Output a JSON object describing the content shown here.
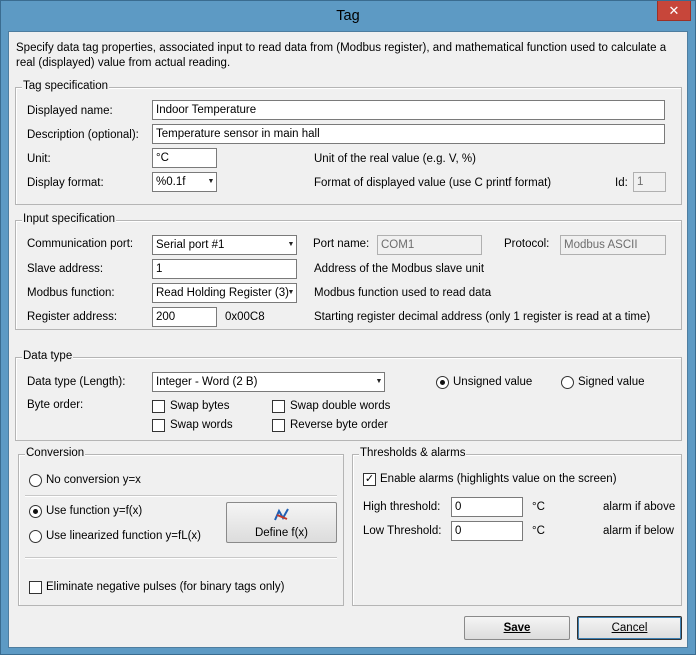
{
  "window": {
    "title": "Tag",
    "close_glyph": "✕"
  },
  "intro": "Specify data tag properties, associated input to read data from (Modbus register), and mathematical function used to calculate a real (displayed) value from actual reading.",
  "tag_spec": {
    "legend": "Tag specification",
    "displayed_name_label": "Displayed name:",
    "displayed_name_value": "Indoor Temperature",
    "description_label": "Description (optional):",
    "description_value": "Temperature sensor in main hall",
    "unit_label": "Unit:",
    "unit_value": "°C",
    "unit_hint": "Unit of the real value (e.g. V, %)",
    "format_label": "Display format:",
    "format_value": "%0.1f",
    "format_hint": "Format of displayed value (use C printf format)",
    "id_label": "Id:",
    "id_value": "1"
  },
  "input_spec": {
    "legend": "Input specification",
    "comm_port_label": "Communication port:",
    "comm_port_value": "Serial port #1",
    "port_name_label": "Port name:",
    "port_name_value": "COM1",
    "protocol_label": "Protocol:",
    "protocol_value": "Modbus ASCII",
    "slave_label": "Slave address:",
    "slave_value": "1",
    "slave_hint": "Address of the Modbus slave unit",
    "function_label": "Modbus function:",
    "function_value": "Read Holding Register (3)",
    "function_hint": "Modbus function used to read data",
    "register_label": "Register address:",
    "register_value": "200",
    "register_hex": "0x00C8",
    "register_hint": "Starting register decimal address (only 1 register is read at a time)"
  },
  "data_type": {
    "legend": "Data type",
    "type_label": "Data type (Length):",
    "type_value": "Integer - Word (2 B)",
    "unsigned_label": "Unsigned value",
    "signed_label": "Signed value",
    "byte_order_label": "Byte order:",
    "swap_bytes": "Swap bytes",
    "swap_double_words": "Swap double words",
    "swap_words": "Swap words",
    "reverse_byte_order": "Reverse byte order"
  },
  "conversion": {
    "legend": "Conversion",
    "no_conversion": "No conversion y=x",
    "use_function": "Use function y=f(x)",
    "use_linearized": "Use linearized function y=fL(x)",
    "define_button": "Define f(x)",
    "eliminate_negative": "Eliminate negative pulses (for binary tags only)"
  },
  "thresholds": {
    "legend": "Thresholds & alarms",
    "enable_alarms": "Enable alarms (highlights value on the screen)",
    "high_label": "High threshold:",
    "high_value": "0",
    "high_unit": "°C",
    "high_hint": "alarm if above",
    "low_label": "Low Threshold:",
    "low_value": "0",
    "low_unit": "°C",
    "low_hint": "alarm if below"
  },
  "buttons": {
    "save": "Save",
    "cancel": "Cancel"
  }
}
